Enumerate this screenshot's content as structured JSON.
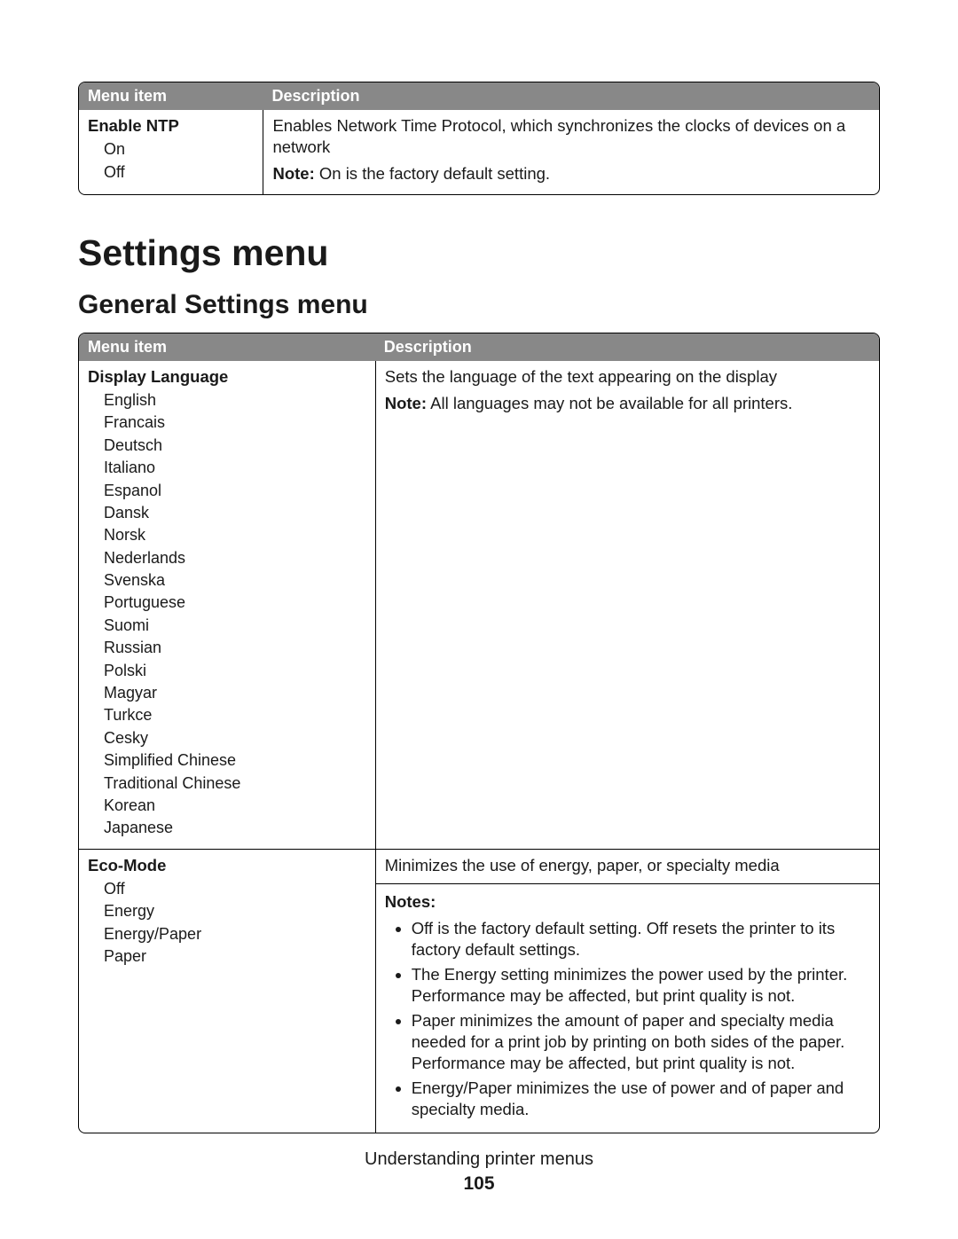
{
  "table1": {
    "head": {
      "c1": "Menu item",
      "c2": "Description"
    },
    "row": {
      "item": "Enable NTP",
      "opts": [
        "On",
        "Off"
      ],
      "desc": "Enables Network Time Protocol, which synchronizes the clocks of devices on a network",
      "note_label": "Note:",
      "note_text": " On is the factory default setting."
    }
  },
  "h1": "Settings menu",
  "h2": "General Settings menu",
  "table2": {
    "head": {
      "c1": "Menu item",
      "c2": "Description"
    },
    "row1": {
      "item": "Display Language",
      "opts": [
        "English",
        "Francais",
        "Deutsch",
        "Italiano",
        "Espanol",
        "Dansk",
        "Norsk",
        "Nederlands",
        "Svenska",
        "Portuguese",
        "Suomi",
        "Russian",
        "Polski",
        "Magyar",
        "Turkce",
        "Cesky",
        "Simplified Chinese",
        "Traditional Chinese",
        "Korean",
        "Japanese"
      ],
      "desc": "Sets the language of the text appearing on the display",
      "note_label": "Note:",
      "note_text": " All languages may not be available for all printers."
    },
    "row2": {
      "item": "Eco-Mode",
      "opts": [
        "Off",
        "Energy",
        "Energy/Paper",
        "Paper"
      ],
      "desc": "Minimizes the use of energy, paper, or specialty media",
      "notes_label": "Notes:",
      "notes": [
        "Off is the factory default setting. Off resets the printer to its factory default settings.",
        "The Energy setting minimizes the power used by the printer. Performance may be affected, but print quality is not.",
        "Paper minimizes the amount of paper and specialty media needed for a print job by printing on both sides of the paper. Performance may be affected, but print quality is not.",
        "Energy/Paper minimizes the use of power and of paper and specialty media."
      ]
    }
  },
  "footer": {
    "title": "Understanding printer menus",
    "page": "105"
  }
}
